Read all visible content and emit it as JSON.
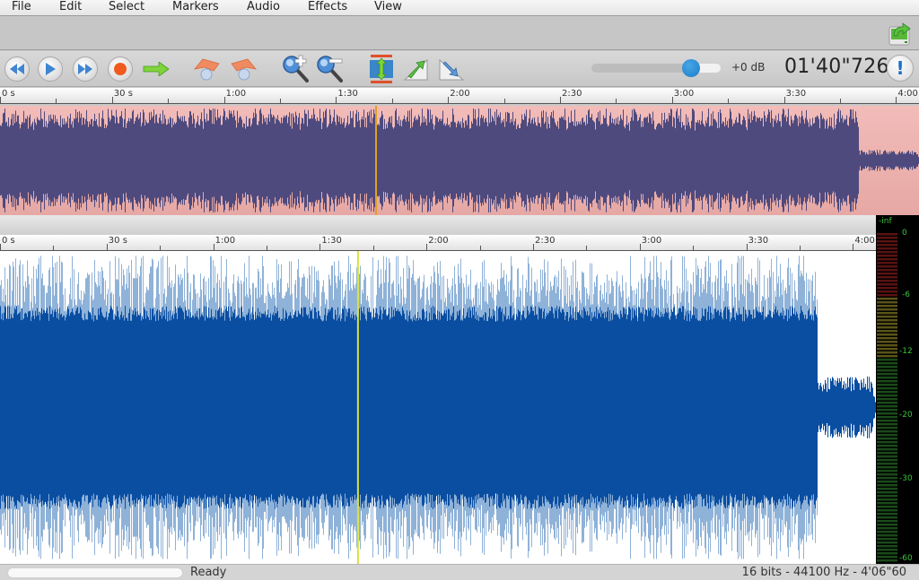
{
  "menu": {
    "items": [
      "File",
      "Edit",
      "Select",
      "Markers",
      "Audio",
      "Effects",
      "View"
    ]
  },
  "toolbar": {
    "buttons": [
      {
        "name": "rewind-button",
        "icon": "rewind-icon"
      },
      {
        "name": "play-button",
        "icon": "play-icon"
      },
      {
        "name": "fast-forward-button",
        "icon": "fast-forward-icon"
      },
      {
        "name": "record-button",
        "icon": "record-icon"
      },
      {
        "name": "go-to-button",
        "icon": "arrow-right-icon"
      },
      {
        "name": "undo-button",
        "icon": "undo-icon"
      },
      {
        "name": "redo-button",
        "icon": "redo-icon"
      },
      {
        "name": "zoom-in-button",
        "icon": "zoom-in-icon"
      },
      {
        "name": "zoom-out-button",
        "icon": "zoom-out-icon"
      },
      {
        "name": "zoom-fit-button",
        "icon": "fit-vertical-icon"
      },
      {
        "name": "fade-in-button",
        "icon": "fade-in-icon"
      },
      {
        "name": "fade-out-button",
        "icon": "fade-out-icon"
      }
    ],
    "volume": {
      "label": "+0 dB",
      "value_fraction": 0.77
    },
    "time_display": "01'40\"726",
    "info_label": "!",
    "export_icon": "export-icon"
  },
  "overview_ruler": {
    "labels": [
      "0 s",
      "30 s",
      "1:00",
      "1:30",
      "2:00",
      "2:30",
      "3:00",
      "3:30",
      "4:00"
    ]
  },
  "main_ruler": {
    "labels": [
      "0 s",
      "30 s",
      "1:00",
      "1:30",
      "2:00",
      "2:30",
      "3:00",
      "3:30",
      "4:00"
    ]
  },
  "waveform": {
    "duration_seconds": 246.6,
    "cursor_seconds": 100.726,
    "overview_color": "#4e4a7e",
    "overview_bg": "#eeb3af",
    "main_color": "#0a4ea2",
    "main_peak_color": "#8fb2d8",
    "cursor_overview_color": "#e0a020",
    "cursor_main_color": "#d8e040",
    "loud_end_seconds": 230
  },
  "level_meter": {
    "labels": [
      "-inf",
      "0",
      "-6",
      "-12",
      "-20",
      "-30",
      "-60"
    ],
    "color_red": "#5a1212",
    "color_yellow": "#5a5418",
    "color_green": "#1a4a1a",
    "label_color": "#39c539"
  },
  "status": {
    "text": "Ready",
    "format": "16 bits - 44100 Hz - 4'06\"60"
  }
}
